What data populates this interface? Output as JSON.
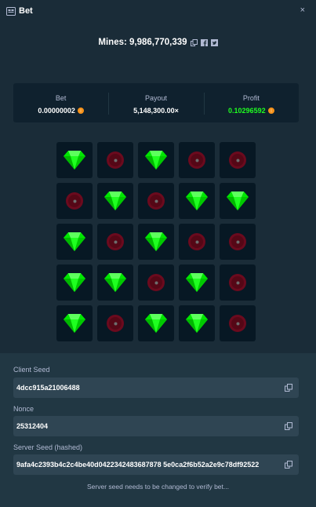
{
  "header": {
    "title": "Bet",
    "close_glyph": "×"
  },
  "summary": {
    "mines_text": "Mines: 9,986,770,339"
  },
  "stats": [
    {
      "label": "Bet",
      "value": "0.00000002",
      "value_color": "#ffffff",
      "coin": true
    },
    {
      "label": "Payout",
      "value": "5,148,300.00×",
      "value_color": "#ffffff",
      "coin": false
    },
    {
      "label": "Profit",
      "value": "0.10296592",
      "value_color": "#1fff20",
      "coin": true
    }
  ],
  "grid": [
    [
      "gem",
      "mine",
      "gem",
      "mine",
      "mine"
    ],
    [
      "mine",
      "gem",
      "mine",
      "gem",
      "gem"
    ],
    [
      "gem",
      "mine",
      "gem",
      "mine",
      "mine"
    ],
    [
      "gem",
      "gem",
      "mine",
      "gem",
      "mine"
    ],
    [
      "gem",
      "mine",
      "gem",
      "gem",
      "mine"
    ]
  ],
  "fields": {
    "client_seed": {
      "label": "Client Seed",
      "value": "4dcc915a21006488"
    },
    "nonce": {
      "label": "Nonce",
      "value": "25312404"
    },
    "server_seed": {
      "label": "Server Seed (hashed)",
      "value": "9afa4c2393b4c2c4be40d0422342483687878 5e0ca2f6b52a2e9c78df92522"
    }
  },
  "note": "Server seed needs to be changed to verify bet...",
  "colors": {
    "gem": "#00e701",
    "mine": "#6b0a1e",
    "accent_green": "#1fff20",
    "coin": "#f7931a"
  },
  "icons": {
    "title": "bet-ticket-icon",
    "copy": "copy-icon",
    "facebook": "facebook-icon",
    "twitter": "twitter-icon",
    "close": "close-icon"
  }
}
